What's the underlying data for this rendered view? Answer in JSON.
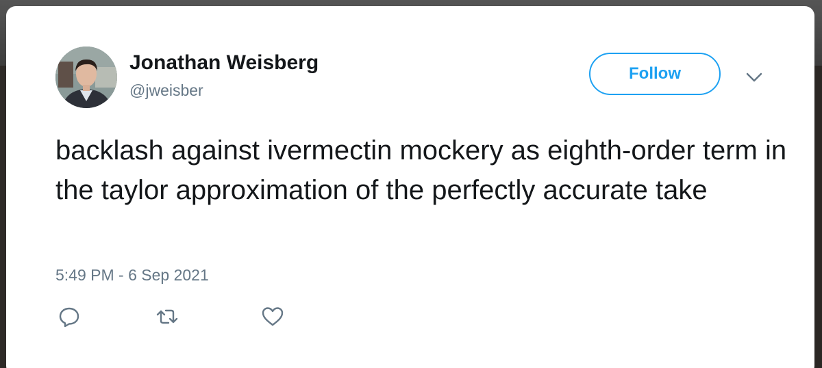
{
  "tweet": {
    "author_name": "Jonathan Weisberg",
    "author_handle": "@jweisber",
    "follow_label": "Follow",
    "text": "backlash against ivermectin mockery as eighth-order term in the taylor approximation of the perfectly accurate take",
    "timestamp": "5:49 PM - 6 Sep 2021"
  },
  "icons": {
    "more": "chevron-down-icon",
    "reply": "reply-icon",
    "retweet": "retweet-icon",
    "like": "heart-icon"
  },
  "colors": {
    "accent": "#1da1f2",
    "text": "#14171a",
    "muted": "#657786",
    "icon": "#657786"
  }
}
